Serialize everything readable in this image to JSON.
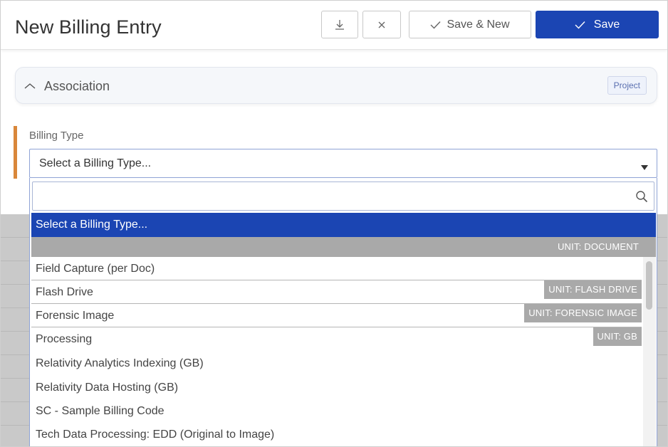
{
  "header": {
    "title": "New Billing Entry",
    "buttons": {
      "collapse_icon": "align-bottom-icon",
      "close_icon": "close-icon",
      "save_new_label": "Save & New",
      "save_label": "Save"
    }
  },
  "association": {
    "label": "Association",
    "tag": "Project"
  },
  "billing_type": {
    "label": "Billing Type",
    "selected_value": "Select a Billing Type...",
    "dropdown": {
      "search_value": "",
      "selected_option": "Select a Billing Type...",
      "group_unit": "UNIT: DOCUMENT",
      "options": [
        {
          "label": "Field Capture (per Doc)",
          "unit": ""
        },
        {
          "label": "Flash Drive",
          "unit": "UNIT: FLASH DRIVE"
        },
        {
          "label": "Forensic Image",
          "unit": "UNIT: FORENSIC IMAGE"
        },
        {
          "label": "Processing",
          "unit": "UNIT: GB"
        },
        {
          "label": "Relativity Analytics Indexing (GB)",
          "unit": ""
        },
        {
          "label": "Relativity Data Hosting (GB)",
          "unit": ""
        },
        {
          "label": "SC - Sample Billing Code",
          "unit": ""
        },
        {
          "label": "Tech Data Processing: EDD (Original to Image)",
          "unit": ""
        }
      ]
    }
  },
  "colors": {
    "primary": "#1b45b3",
    "required_marker": "#d9873a",
    "unit_badge": "#a9a9a9"
  }
}
